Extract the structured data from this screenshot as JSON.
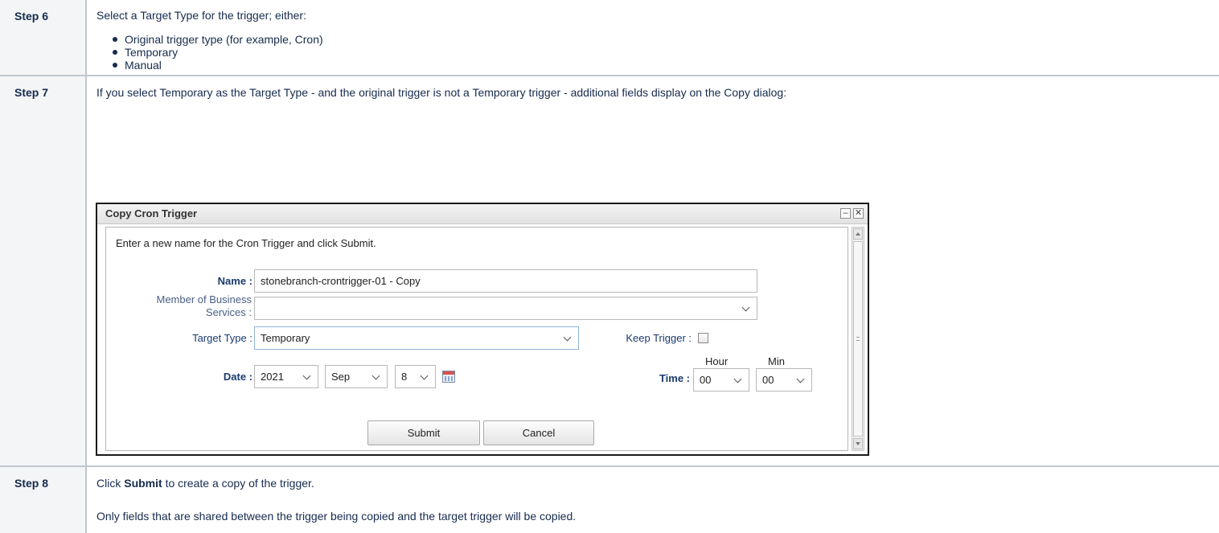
{
  "steps": [
    {
      "label": "Step 6",
      "intro": "Select a Target Type for the trigger; either:",
      "bullets": [
        "Original trigger type (for example, Cron)",
        "Temporary",
        "Manual"
      ]
    },
    {
      "label": "Step 7",
      "intro": "If you select Temporary as the Target Type - and the original trigger is not a Temporary trigger - additional fields display on the Copy dialog:"
    },
    {
      "label": "Step 8",
      "click_prefix": "Click ",
      "click_bold": "Submit",
      "click_suffix": " to create a copy of the trigger.",
      "note": "Only fields that are shared between the trigger being copied and the target trigger will be copied."
    }
  ],
  "dialog": {
    "title": "Copy Cron Trigger",
    "minimize_glyph": "–",
    "close_glyph": "✕",
    "instruction": "Enter a new name for the Cron Trigger and click Submit.",
    "name_label": "Name :",
    "name_value": "stonebranch-crontrigger-01 - Copy",
    "member_label_line1": "Member of Business",
    "member_label_line2": "Services :",
    "member_value": "",
    "target_type_label": "Target Type :",
    "target_type_value": "Temporary",
    "keep_trigger_label": "Keep Trigger :",
    "keep_trigger_checked": false,
    "date_label": "Date :",
    "date_year": "2021",
    "date_month": "Sep",
    "date_day": "8",
    "time_label": "Time :",
    "hour_header": "Hour",
    "min_header": "Min",
    "hour_value": "00",
    "min_value": "00",
    "submit_label": "Submit",
    "cancel_label": "Cancel"
  }
}
